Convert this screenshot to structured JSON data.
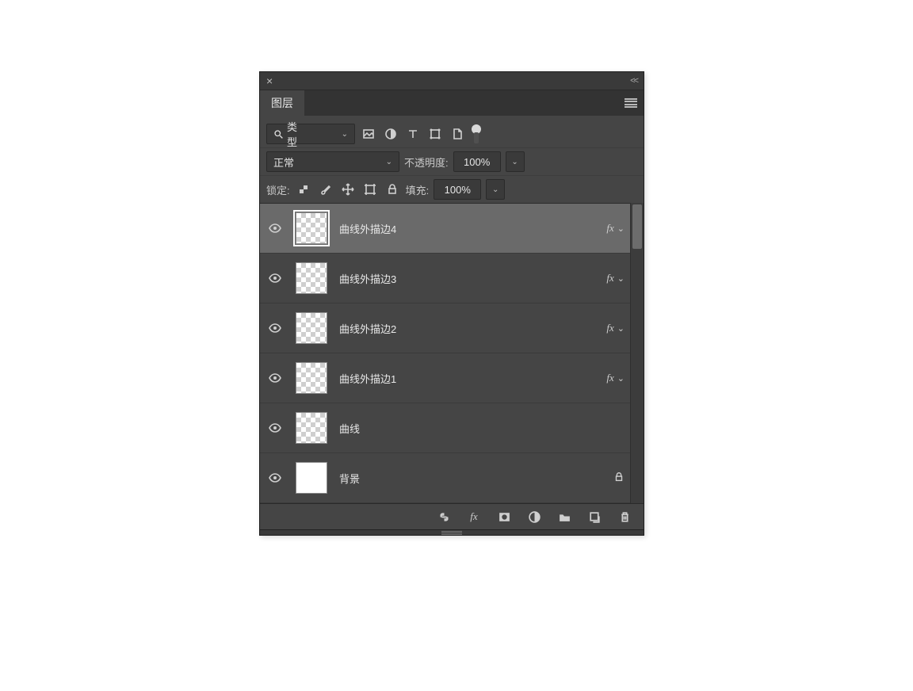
{
  "panel": {
    "tab_title": "图层",
    "filter": {
      "kind_label": "类型",
      "blend_mode": "正常",
      "opacity_label": "不透明度:",
      "opacity_value": "100%",
      "lock_label": "锁定:",
      "fill_label": "填充:",
      "fill_value": "100%"
    },
    "layers": [
      {
        "name": "曲线外描边4",
        "fx": true,
        "thumb": "checker",
        "selected": true,
        "locked": false
      },
      {
        "name": "曲线外描边3",
        "fx": true,
        "thumb": "checker",
        "selected": false,
        "locked": false
      },
      {
        "name": "曲线外描边2",
        "fx": true,
        "thumb": "checker",
        "selected": false,
        "locked": false
      },
      {
        "name": "曲线外描边1",
        "fx": true,
        "thumb": "checker",
        "selected": false,
        "locked": false
      },
      {
        "name": "曲线",
        "fx": false,
        "thumb": "checker",
        "selected": false,
        "locked": false
      },
      {
        "name": "背景",
        "fx": false,
        "thumb": "white",
        "selected": false,
        "locked": true
      }
    ]
  },
  "icons": {
    "search": "search-icon",
    "image": "image-filter-icon",
    "adjust": "adjustment-filter-icon",
    "text": "text-filter-icon",
    "shape": "shape-filter-icon",
    "smart": "smartobject-filter-icon",
    "pixel_lock": "lock-pixels-icon",
    "brush": "brush-icon",
    "move": "move-icon",
    "artboard": "artboard-lock-icon",
    "lock": "lock-icon",
    "link": "link-icon",
    "fx": "fx-icon",
    "mask": "mask-icon",
    "adjust_circle": "adjustment-icon",
    "folder": "folder-icon",
    "new": "new-layer-icon",
    "trash": "trash-icon",
    "eye": "visibility-icon"
  }
}
